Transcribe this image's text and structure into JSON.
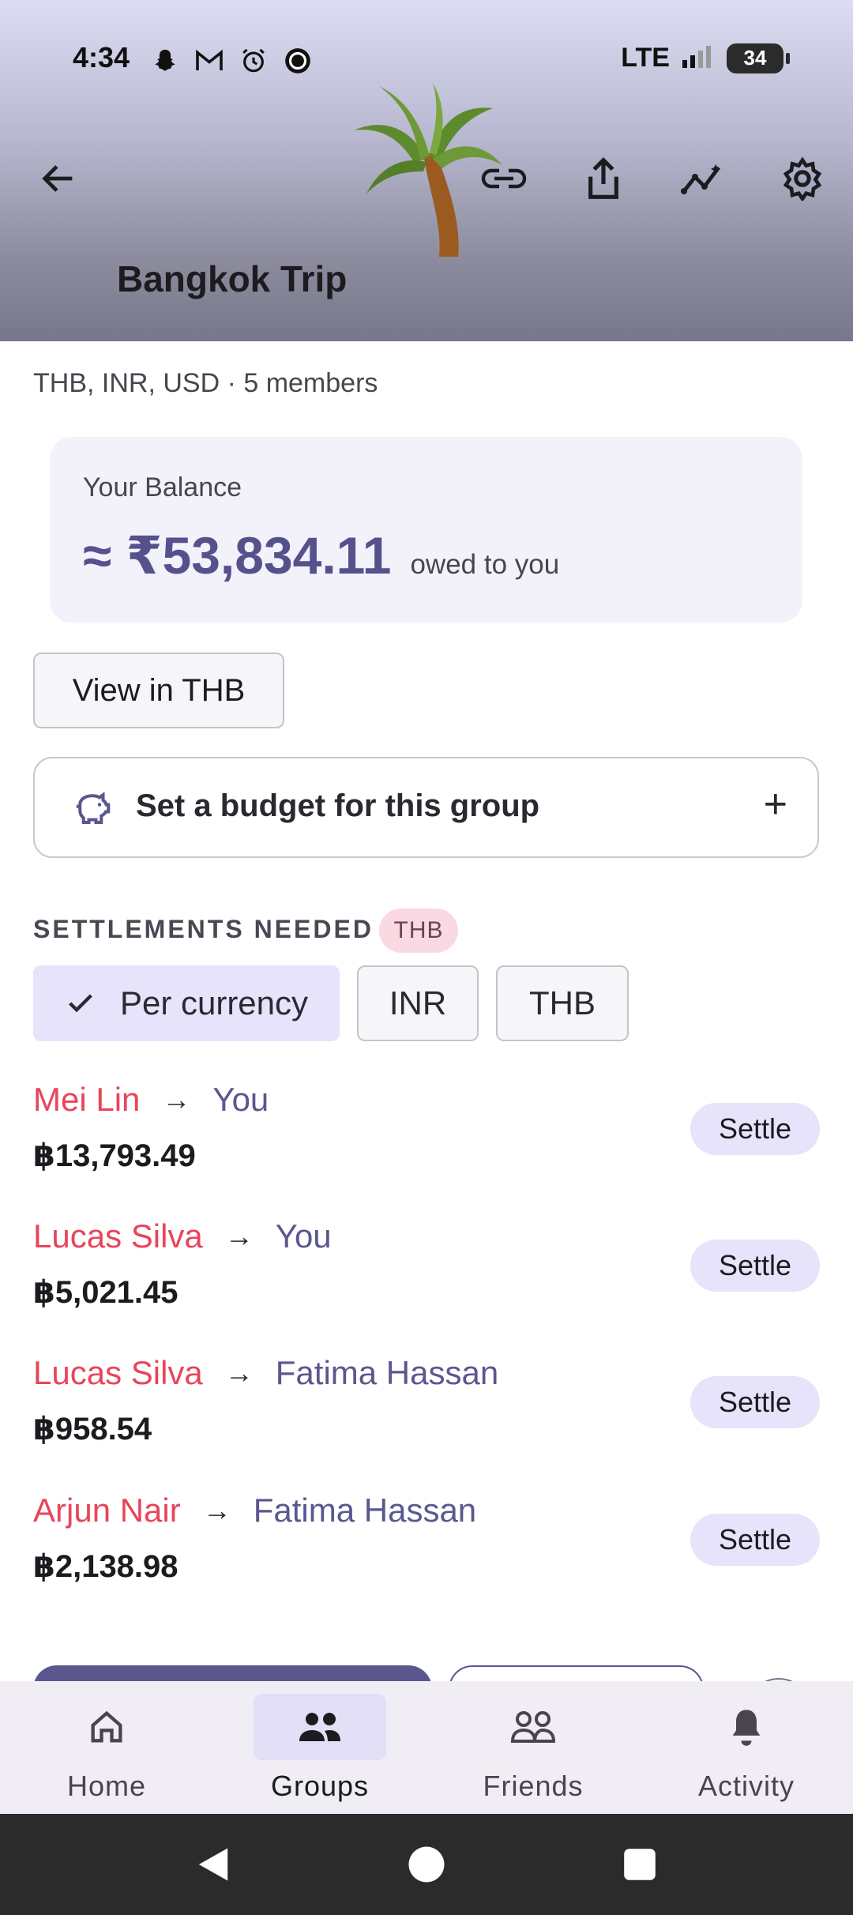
{
  "status_bar": {
    "time": "4:34",
    "network": "LTE",
    "battery": "34"
  },
  "header": {
    "title": "Bangkok Trip",
    "icons": [
      "back-arrow-icon",
      "link-icon",
      "share-icon",
      "insights-icon",
      "gear-icon"
    ],
    "cover_emoji": "palm-tree"
  },
  "group_info": {
    "subline": "THB, INR, USD · 5 members"
  },
  "balance": {
    "label": "Your Balance",
    "amount": "≈ ₹53,834.11",
    "suffix": "owed to you"
  },
  "view_currency_button": "View in THB",
  "budget": {
    "label": "Set a budget for this group",
    "plus": "+"
  },
  "settlements": {
    "heading": "SETTLEMENTS NEEDED",
    "badge": "THB",
    "filters": [
      {
        "label": "Per currency",
        "selected": true
      },
      {
        "label": "INR",
        "selected": false
      },
      {
        "label": "THB",
        "selected": false
      }
    ],
    "arrow": "→",
    "rows": [
      {
        "from": "Mei Lin",
        "to": "You",
        "amount": "฿13,793.49",
        "action": "Settle"
      },
      {
        "from": "Lucas Silva",
        "to": "You",
        "amount": "฿5,021.45",
        "action": "Settle"
      },
      {
        "from": "Lucas Silva",
        "to": "Fatima Hassan",
        "amount": "฿958.54",
        "action": "Settle"
      },
      {
        "from": "Arjun Nair",
        "to": "Fatima Hassan",
        "amount": "฿2,138.98",
        "action": "Settle"
      }
    ]
  },
  "bottom_nav": {
    "items": [
      {
        "label": "Home",
        "icon": "home-icon"
      },
      {
        "label": "Groups",
        "icon": "groups-icon",
        "active": true
      },
      {
        "label": "Friends",
        "icon": "friends-icon"
      },
      {
        "label": "Activity",
        "icon": "bell-icon"
      }
    ]
  },
  "colors": {
    "accent": "#55518c",
    "debtor": "#e8455a",
    "creditor": "#5a578f",
    "chip_selected": "#e6e3fb"
  }
}
